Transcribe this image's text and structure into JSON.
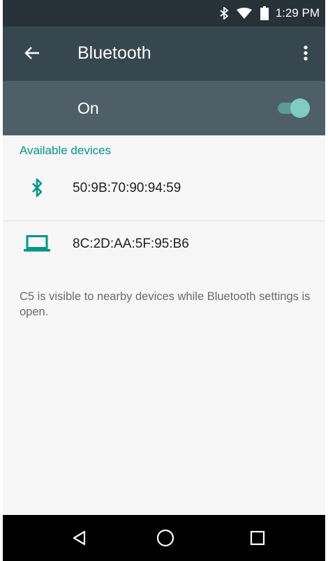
{
  "status_bar": {
    "time": "1:29 PM",
    "icons": [
      "bluetooth-icon",
      "wifi-icon",
      "battery-icon"
    ]
  },
  "toolbar": {
    "title": "Bluetooth",
    "back_icon": "arrow-back-icon",
    "menu_icon": "more-vert-icon"
  },
  "switch_bar": {
    "label": "On",
    "state": "on"
  },
  "devices_section": {
    "header": "Available devices",
    "items": [
      {
        "name": "50:9B:70:90:94:59",
        "icon": "bluetooth-icon"
      },
      {
        "name": "8C:2D:AA:5F:95:B6",
        "icon": "laptop-icon"
      }
    ]
  },
  "footer_text": "C5 is visible to nearby devices while Bluetooth settings is open.",
  "nav_bar": {
    "buttons": [
      "back-triangle-icon",
      "home-circle-icon",
      "recents-square-icon"
    ]
  },
  "colors": {
    "accent": "#009688",
    "toolbar": "#37474f",
    "switch_bar": "#4e5f68",
    "status_bar": "#263238"
  }
}
